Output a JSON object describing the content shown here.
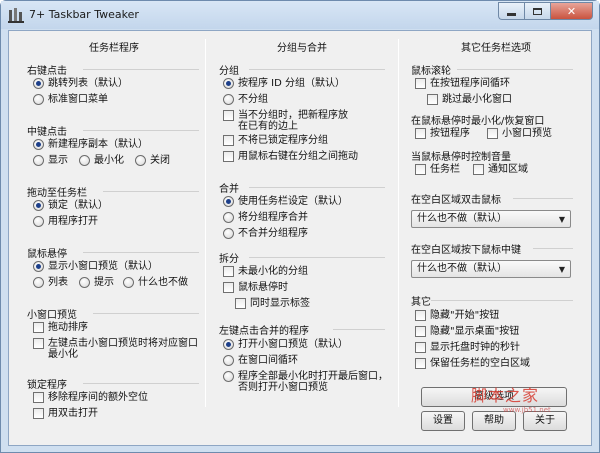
{
  "window": {
    "title": "7+ Taskbar Tweaker"
  },
  "columns": {
    "taskbar": {
      "heading": "任务栏程序",
      "right_click": {
        "label": "右键点击",
        "options": [
          "跳转列表（默认）",
          "标准窗口菜单"
        ],
        "selected": 0
      },
      "middle_click": {
        "label": "中键点击",
        "options": [
          "新建程序副本（默认）",
          "显示",
          "最小化",
          "关闭"
        ],
        "selected": 0
      },
      "drag_to_taskbar": {
        "label": "拖动至任务栏",
        "options": [
          "锁定（默认）",
          "用程序打开"
        ],
        "selected": 0
      },
      "hover": {
        "label": "鼠标悬停",
        "options": [
          "显示小窗口预览（默认）",
          "列表",
          "提示",
          "什么也不做"
        ],
        "selected": 0
      },
      "thumbnail": {
        "label": "小窗口预览",
        "checks": [
          "拖动排序",
          "左键点击小窗口预览时将对应窗口最小化"
        ]
      },
      "pinned": {
        "label": "锁定程序",
        "checks": [
          "移除程序间的额外空位",
          "用双击打开"
        ]
      }
    },
    "grouping": {
      "heading": "分组与合并",
      "group": {
        "label": "分组",
        "options": [
          "按程序 ID 分组（默认）",
          "不分组"
        ],
        "selected": 0,
        "checks": [
          "当不分组时，把新程序放在已有的边上",
          "不将已锁定程序分组",
          "用鼠标右键在分组之间拖动"
        ]
      },
      "combine": {
        "label": "合并",
        "options": [
          "使用任务栏设定（默认）",
          "将分组程序合并",
          "不合并分组程序"
        ],
        "selected": 0
      },
      "split": {
        "label": "拆分",
        "checks": [
          "未最小化的分组",
          "鼠标悬停时",
          "同时显示标签"
        ]
      },
      "left_click_combined": {
        "label": "左键点击合并的程序",
        "options": [
          "打开小窗口预览（默认）",
          "在窗口间循环",
          "程序全部最小化时打开最后窗口，否则打开小窗口预览"
        ],
        "selected": 0
      }
    },
    "other": {
      "heading": "其它任务栏选项",
      "wheel": {
        "label": "鼠标滚轮",
        "checks": [
          "在按钮程序间循环",
          "跳过最小化窗口"
        ],
        "minmax_label": "在鼠标悬停时最小化/恢复窗口",
        "minmax_checks": [
          "按钮程序",
          "小窗口预览"
        ],
        "volume_label": "当鼠标悬停时控制音量",
        "volume_checks": [
          "任务栏",
          "通知区域"
        ]
      },
      "double_click_empty": {
        "label": "在空白区域双击鼠标",
        "value": "什么也不做（默认）"
      },
      "middle_click_empty": {
        "label": "在空白区域按下鼠标中键",
        "value": "什么也不做（默认）"
      },
      "misc": {
        "label": "其它",
        "checks": [
          "隐藏\"开始\"按钮",
          "隐藏\"显示桌面\"按钮",
          "显示托盘时钟的秒针",
          "保留任务栏的空白区域"
        ]
      }
    }
  },
  "buttons": {
    "advanced": "高级选项",
    "settings": "设置",
    "help": "帮助",
    "about": "关于"
  },
  "watermark": {
    "text": "脚本之家",
    "url": "www.jb51.net"
  },
  "icons": {
    "app": "tweaker-app-icon",
    "minimize": "minimize-icon",
    "maximize": "maximize-icon",
    "close": "close-icon",
    "dropdown": "chevron-down-icon"
  }
}
